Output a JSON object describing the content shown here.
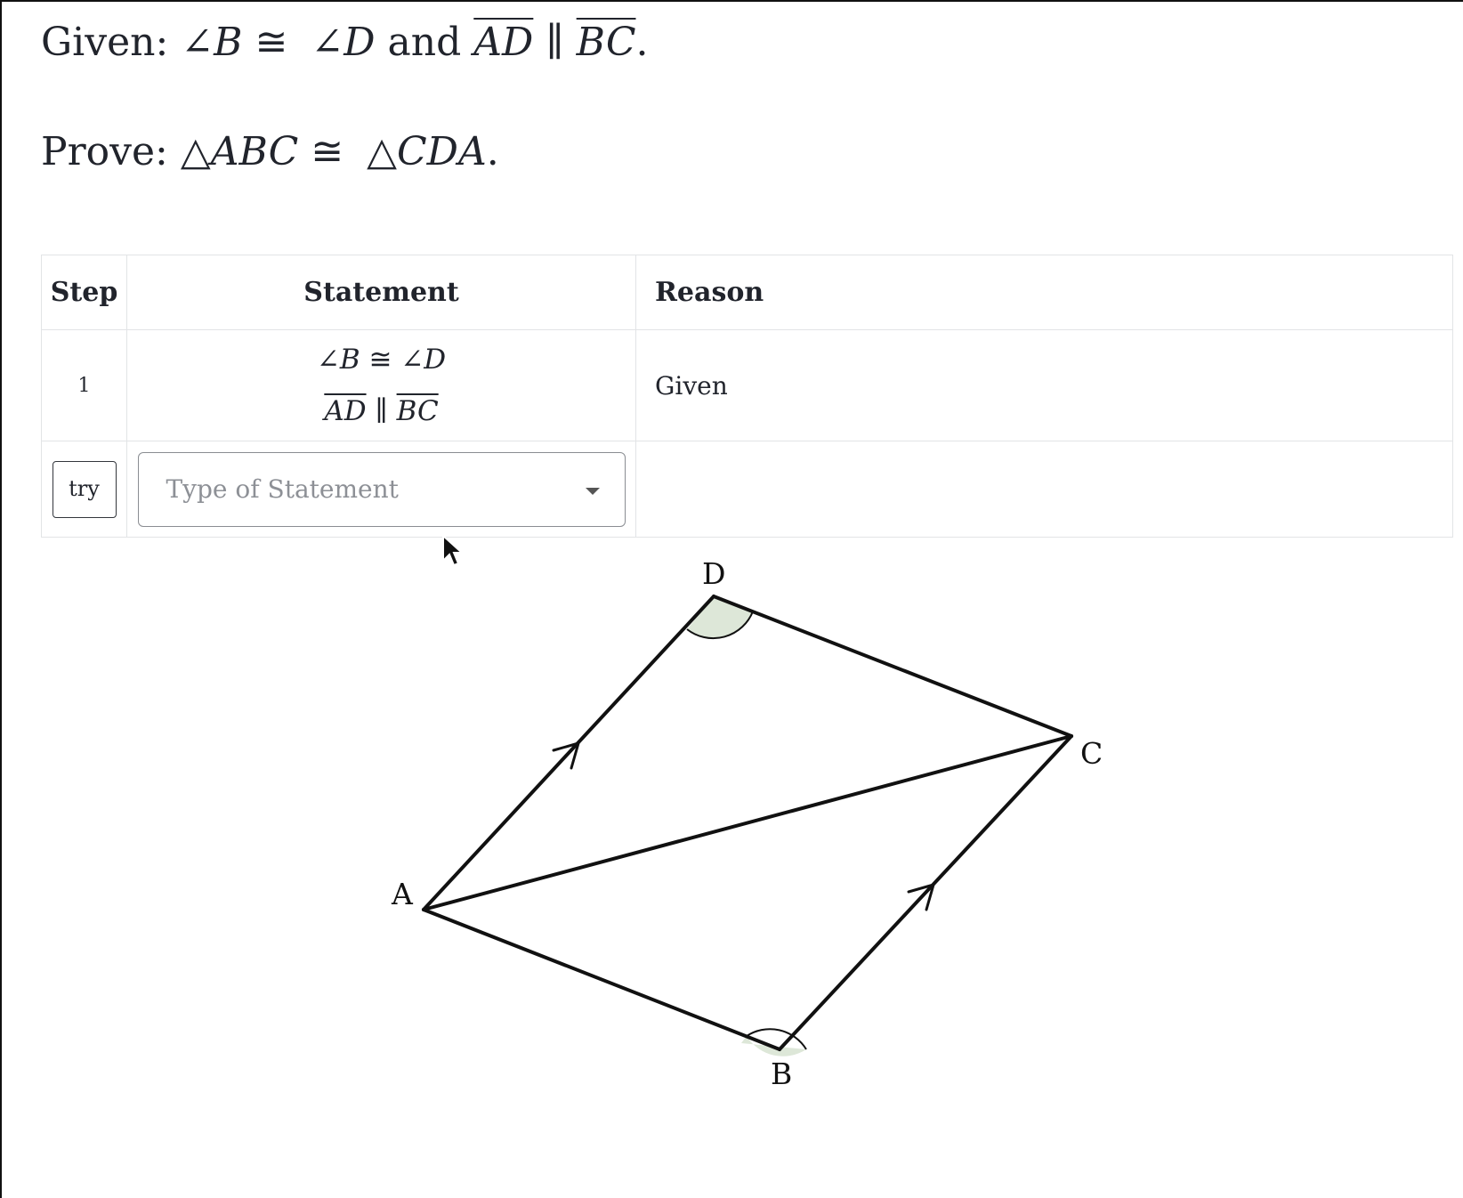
{
  "problem": {
    "given_label": "Given:",
    "given_and": "and",
    "angle_b": "B",
    "angle_d": "D",
    "seg_ad": "AD",
    "seg_bc": "BC",
    "prove_label": "Prove:",
    "tri_1": "ABC",
    "tri_2": "CDA"
  },
  "table": {
    "headers": {
      "step": "Step",
      "statement": "Statement",
      "reason": "Reason"
    },
    "row1": {
      "step": "1",
      "stmt_b": "B",
      "stmt_d": "D",
      "stmt_ad": "AD",
      "stmt_bc": "BC",
      "reason": "Given"
    },
    "row2": {
      "try_label": "try",
      "statement_placeholder": "Type of Statement"
    }
  },
  "figure": {
    "vertices": {
      "a": "A",
      "b": "B",
      "c": "C",
      "d": "D"
    }
  },
  "colors": {
    "angle_fill": "#dde7d8",
    "text": "#21242c"
  }
}
